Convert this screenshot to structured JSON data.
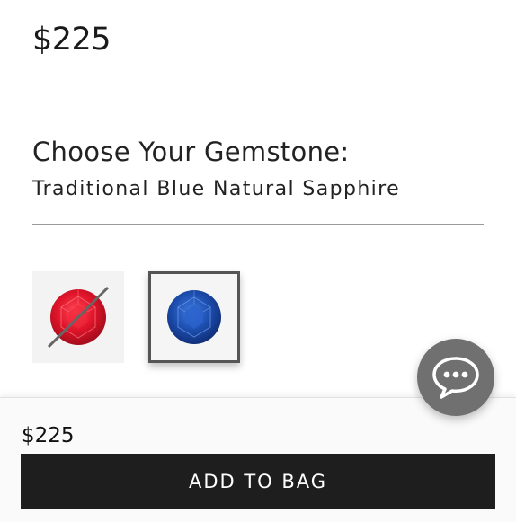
{
  "product": {
    "price": "$225"
  },
  "gemstone": {
    "heading": "Choose Your Gemstone:",
    "selected": "Traditional Blue Natural Sapphire",
    "options": [
      {
        "name": "ruby",
        "icon": "ruby-gem-icon",
        "available": false,
        "selected": false,
        "color": "#d01a2a"
      },
      {
        "name": "sapphire",
        "icon": "sapphire-gem-icon",
        "available": true,
        "selected": true,
        "color": "#1d4fb0"
      }
    ]
  },
  "chat": {
    "icon": "chat-bubble-icon"
  },
  "footer": {
    "price": "$225",
    "add_to_bag_label": "ADD TO BAG"
  },
  "colors": {
    "button_bg": "#1e1e1e",
    "chat_bg": "#707070",
    "selected_border": "#555555"
  }
}
